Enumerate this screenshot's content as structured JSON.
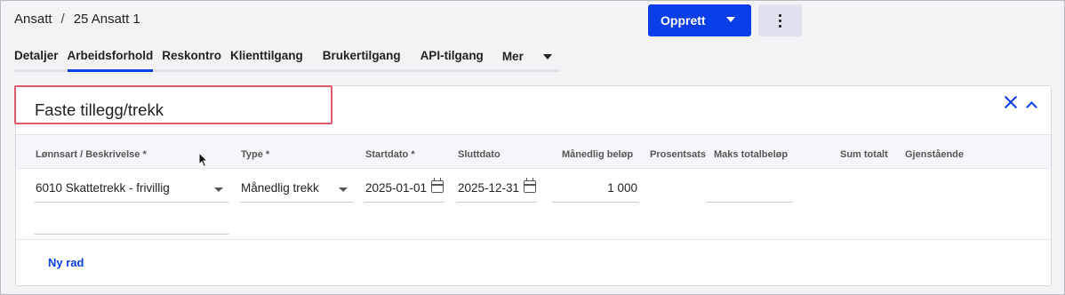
{
  "breadcrumb": {
    "parent": "Ansatt",
    "separator": "/",
    "current": "25 Ansatt 1"
  },
  "actions": {
    "create_label": "Opprett"
  },
  "tabs": [
    {
      "label": "Detaljer",
      "active": false
    },
    {
      "label": "Arbeidsforhold",
      "active": true
    },
    {
      "label": "Reskontro",
      "active": false
    },
    {
      "label": "Klienttilgang",
      "active": false
    },
    {
      "label": "Brukertilgang",
      "active": false
    },
    {
      "label": "API-tilgang",
      "active": false
    },
    {
      "label": "Mer",
      "active": false
    }
  ],
  "section": {
    "title": "Faste tillegg/trekk",
    "columns": [
      "Lønnsart / Beskrivelse *",
      "Type *",
      "Startdato *",
      "Sluttdato",
      "Månedlig beløp",
      "Prosentsats",
      "Maks totalbeløp",
      "Sum totalt",
      "Gjenstående"
    ],
    "row": {
      "lonnsart": "6010 Skattetrekk - frivillig",
      "type": "Månedlig trekk",
      "startdato": "2025-01-01",
      "sluttdato": "2025-12-31",
      "manedlig_belop": "1 000"
    },
    "add_row_label": "Ny rad"
  },
  "colors": {
    "accent": "#0a3ee8",
    "highlight": "#e0586a"
  }
}
